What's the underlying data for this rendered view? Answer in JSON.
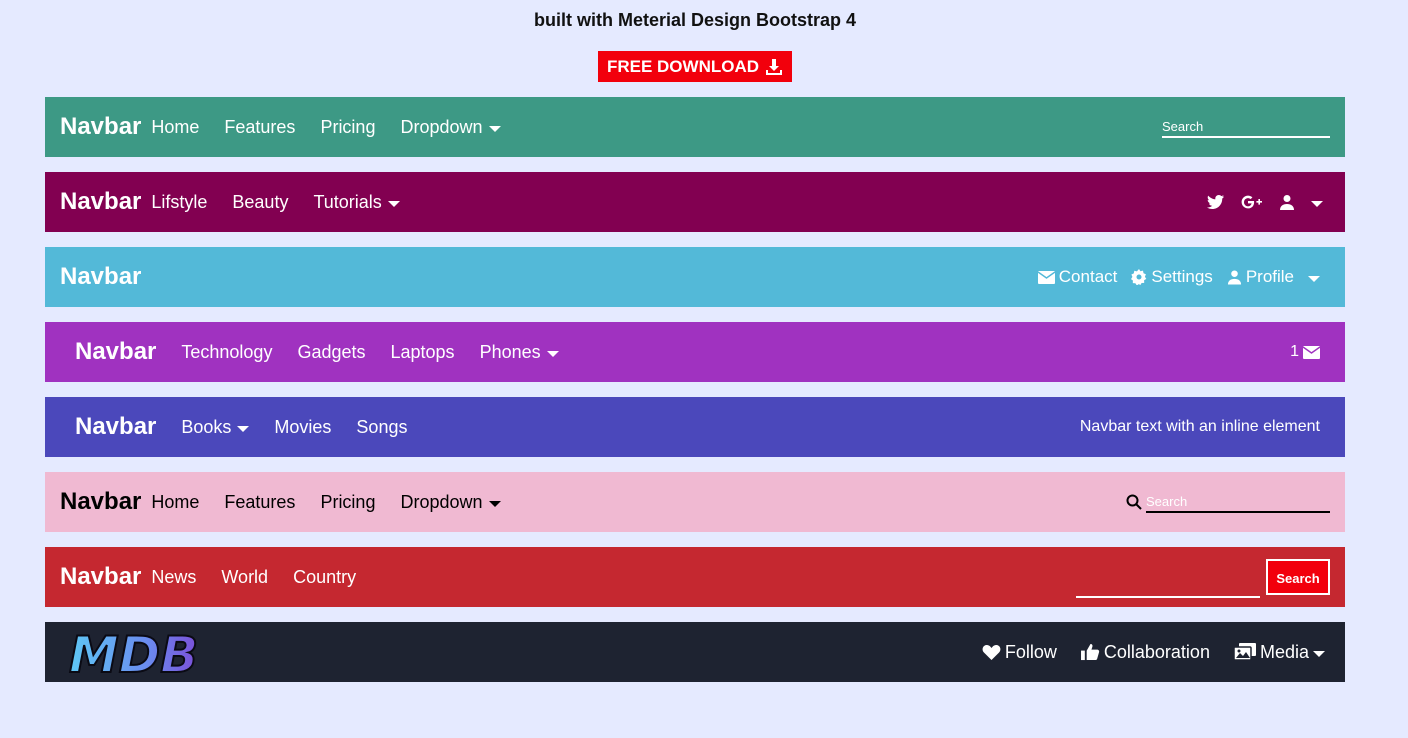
{
  "header": {
    "title": "built with Meterial Design Bootstrap 4",
    "download_label": "FREE DOWNLOAD"
  },
  "navbar1": {
    "brand": "Navbar",
    "items": [
      "Home",
      "Features",
      "Pricing",
      "Dropdown"
    ],
    "search_placeholder": "Search",
    "bg": "#3d9985"
  },
  "navbar2": {
    "brand": "Navbar",
    "items": [
      "Lifstyle",
      "Beauty",
      "Tutorials"
    ],
    "icons": [
      "twitter-icon",
      "google-plus-icon",
      "user-icon",
      "chevron-down-icon"
    ],
    "bg": "#820051"
  },
  "navbar3": {
    "brand": "Navbar",
    "contact": "Contact",
    "settings": "Settings",
    "profile": "Profile",
    "bg": "#53b9d8"
  },
  "navbar4": {
    "brand": "Navbar",
    "items": [
      "Technology",
      "Gadgets",
      "Laptops",
      "Phones"
    ],
    "mail_count": "1",
    "bg": "#a032c0"
  },
  "navbar5": {
    "brand": "Navbar",
    "items": [
      "Books",
      "Movies",
      "Songs"
    ],
    "text": "Navbar text with an inline element",
    "bg": "#4b48bb"
  },
  "navbar6": {
    "brand": "Navbar",
    "items": [
      "Home",
      "Features",
      "Pricing",
      "Dropdown"
    ],
    "search_placeholder": "Search",
    "bg": "#f0b9d2"
  },
  "navbar7": {
    "brand": "Navbar",
    "items": [
      "News",
      "World",
      "Country"
    ],
    "search_button": "Search",
    "bg": "#c52830"
  },
  "navbar8": {
    "logo_text": "MDB",
    "follow": "Follow",
    "collaboration": "Collaboration",
    "media": "Media",
    "bg": "#1e2331"
  }
}
